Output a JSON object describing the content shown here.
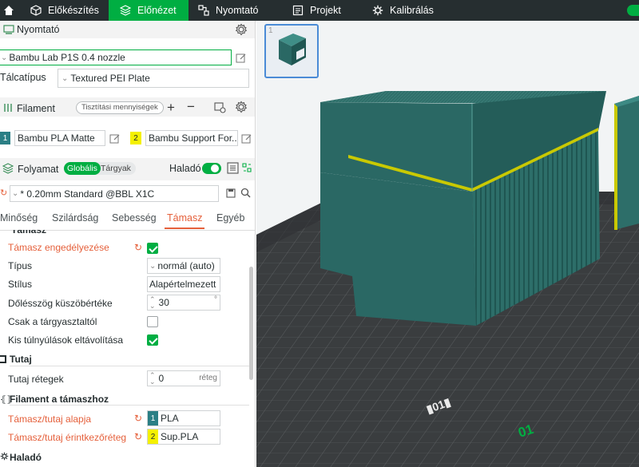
{
  "topbar": {
    "tabs": [
      {
        "label": "Előkészítés",
        "icon": "cube-outline-icon"
      },
      {
        "label": "Előnézet",
        "icon": "layers-icon"
      },
      {
        "label": "Nyomtató",
        "icon": "device-icon"
      },
      {
        "label": "Projekt",
        "icon": "document-icon"
      },
      {
        "label": "Kalibrálás",
        "icon": "gear-icon"
      }
    ],
    "active_index": 1
  },
  "printer": {
    "section_title": "Nyomtató",
    "printer_name": "Bambu Lab P1S 0.4 nozzle",
    "plate_label": "Tálcatípus",
    "plate_value": "Textured PEI Plate"
  },
  "filament": {
    "section_title": "Filament",
    "flush_button": "Tisztítási mennyiségek",
    "slots": [
      {
        "number": "1",
        "name": "Bambu PLA Matte",
        "color": "#2b7f85"
      },
      {
        "number": "2",
        "name": "Bambu Support For...",
        "color": "#f4f000"
      }
    ]
  },
  "process": {
    "section_title": "Folyamat",
    "toggle_global": "Globális",
    "toggle_objects": "Tárgyak",
    "advanced_label": "Haladó",
    "profile": "* 0.20mm Standard @BBL X1C",
    "tabs": [
      "Minőség",
      "Szilárdság",
      "Sebesség",
      "Támasz",
      "Egyéb"
    ],
    "active_tab": "Támasz",
    "cut_group_title": "Támasz"
  },
  "support": {
    "enable_label": "Támasz engedélyezése",
    "enable_checked": true,
    "type_label": "Típus",
    "type_value": "normál (auto)",
    "style_label": "Stílus",
    "style_value": "Alapértelmezett",
    "threshold_label": "Dőlésszög küszöbértéke",
    "threshold_value": "30",
    "threshold_unit": "°",
    "buildplate_label": "Csak a tárgyasztaltól",
    "buildplate_checked": false,
    "small_overhang_label": "Kis túlnyúlások eltávolítása",
    "small_overhang_checked": true
  },
  "raft": {
    "group_title": "Tutaj",
    "layers_label": "Tutaj rétegek",
    "layers_value": "0",
    "layers_unit": "réteg"
  },
  "support_filament": {
    "group_title": "Filament a támaszhoz",
    "base_label": "Támasz/tutaj alapja",
    "base_number": "1",
    "base_value": "PLA",
    "interface_label": "Támasz/tutaj érintkezőréteg",
    "interface_number": "2",
    "interface_value": "Sup.PLA"
  },
  "advanced": {
    "group_title": "Haladó"
  },
  "viewport": {
    "plate_thumbnail_number": "1",
    "plate_number_label": "01",
    "accent_color": "#00ae42",
    "model_color": "#2b6b67"
  }
}
